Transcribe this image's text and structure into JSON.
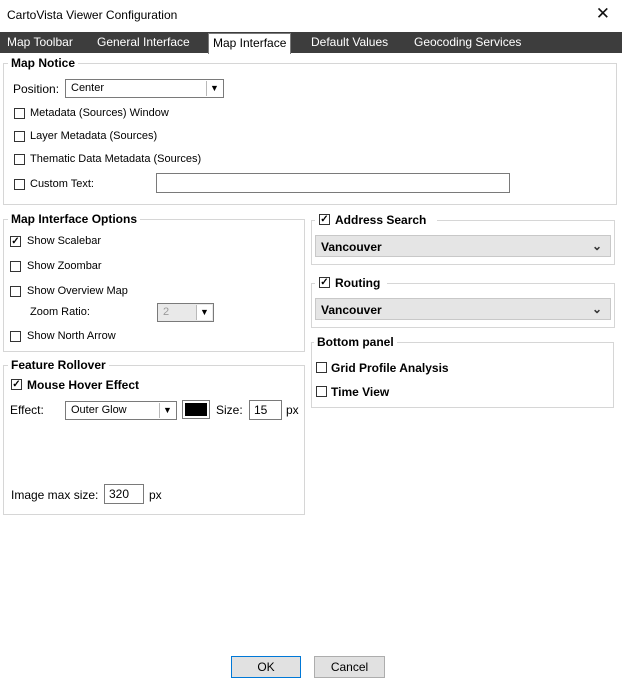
{
  "window": {
    "title": "CartoVista Viewer Configuration",
    "close_glyph": "✕"
  },
  "tabs": [
    {
      "label": "Map Toolbar",
      "active": false
    },
    {
      "label": "General Interface",
      "active": false
    },
    {
      "label": "Map Interface",
      "active": true
    },
    {
      "label": "Default Values",
      "active": false
    },
    {
      "label": "Geocoding Services",
      "active": false
    }
  ],
  "map_notice": {
    "legend": "Map Notice",
    "position_label": "Position:",
    "position_value": "Center",
    "options": [
      {
        "label": "Metadata (Sources) Window",
        "checked": false
      },
      {
        "label": "Layer Metadata (Sources)",
        "checked": false
      },
      {
        "label": "Thematic Data Metadata (Sources)",
        "checked": false
      }
    ],
    "custom_text_label": "Custom Text:",
    "custom_text_value": "",
    "custom_text_checked": false
  },
  "map_interface_options": {
    "legend": "Map Interface Options",
    "show_scalebar": {
      "label": "Show Scalebar",
      "checked": true
    },
    "show_zoombar": {
      "label": "Show Zoombar",
      "checked": false
    },
    "show_overview": {
      "label": "Show Overview Map",
      "checked": false
    },
    "zoom_ratio_label": "Zoom Ratio:",
    "zoom_ratio_value": "2",
    "show_north_arrow": {
      "label": "Show North Arrow",
      "checked": false
    }
  },
  "feature_rollover": {
    "legend": "Feature Rollover",
    "mouse_hover": {
      "label": "Mouse Hover Effect",
      "checked": true
    },
    "effect_label": "Effect:",
    "effect_value": "Outer Glow",
    "color": "#000000",
    "size_label": "Size:",
    "size_value": "15",
    "size_unit": "px",
    "image_max_label": "Image max size:",
    "image_max_value": "320",
    "image_max_unit": "px"
  },
  "address_search": {
    "label": "Address Search",
    "checked": true,
    "value": "Vancouver"
  },
  "routing": {
    "label": "Routing",
    "checked": true,
    "value": "Vancouver"
  },
  "bottom_panel": {
    "legend": "Bottom panel",
    "grid_profile": {
      "label": "Grid Profile Analysis",
      "checked": false
    },
    "time_view": {
      "label": "Time View",
      "checked": false
    }
  },
  "buttons": {
    "ok": "OK",
    "cancel": "Cancel"
  },
  "check_glyph": "✓",
  "colors": {
    "tab_bar": "#3d3d3d",
    "focus_border": "#0078d7",
    "dropdown_bg": "#e5e5e5"
  }
}
